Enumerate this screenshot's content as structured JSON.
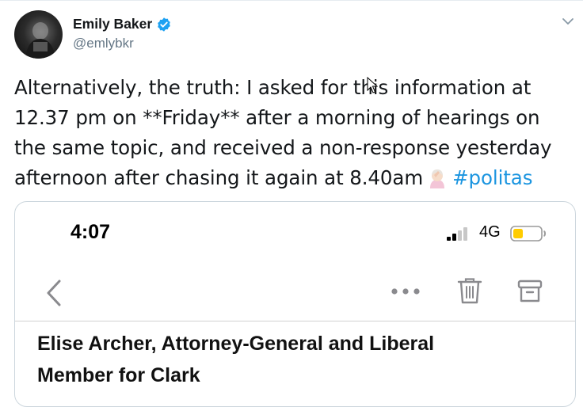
{
  "tweet": {
    "author_name": "Emily Baker",
    "author_handle": "@emlybkr",
    "verified": true,
    "text_lines": [
      "Alternatively, the truth: I asked for this information at",
      "12.37 pm on **Friday** after a morning of hearings on",
      "the same topic, and received a non-response yesterday",
      "afternoon after chasing it again at 8.40am"
    ],
    "hashtag": "#politas",
    "emoji_name": "woman-facepalming-emoji"
  },
  "media": {
    "status_bar": {
      "time": "4:07",
      "network": "4G"
    },
    "toolbar_icons": [
      "back-chevron-icon",
      "more-icon",
      "trash-icon",
      "archive-icon"
    ],
    "email_title_lines": [
      "Elise Archer, Attorney-General and Liberal",
      "Member for Clark"
    ]
  },
  "colors": {
    "hashtag": "#1b95e0",
    "verified": "#1da1f2",
    "secondary_text": "#657786",
    "battery": "#ffcc00"
  }
}
